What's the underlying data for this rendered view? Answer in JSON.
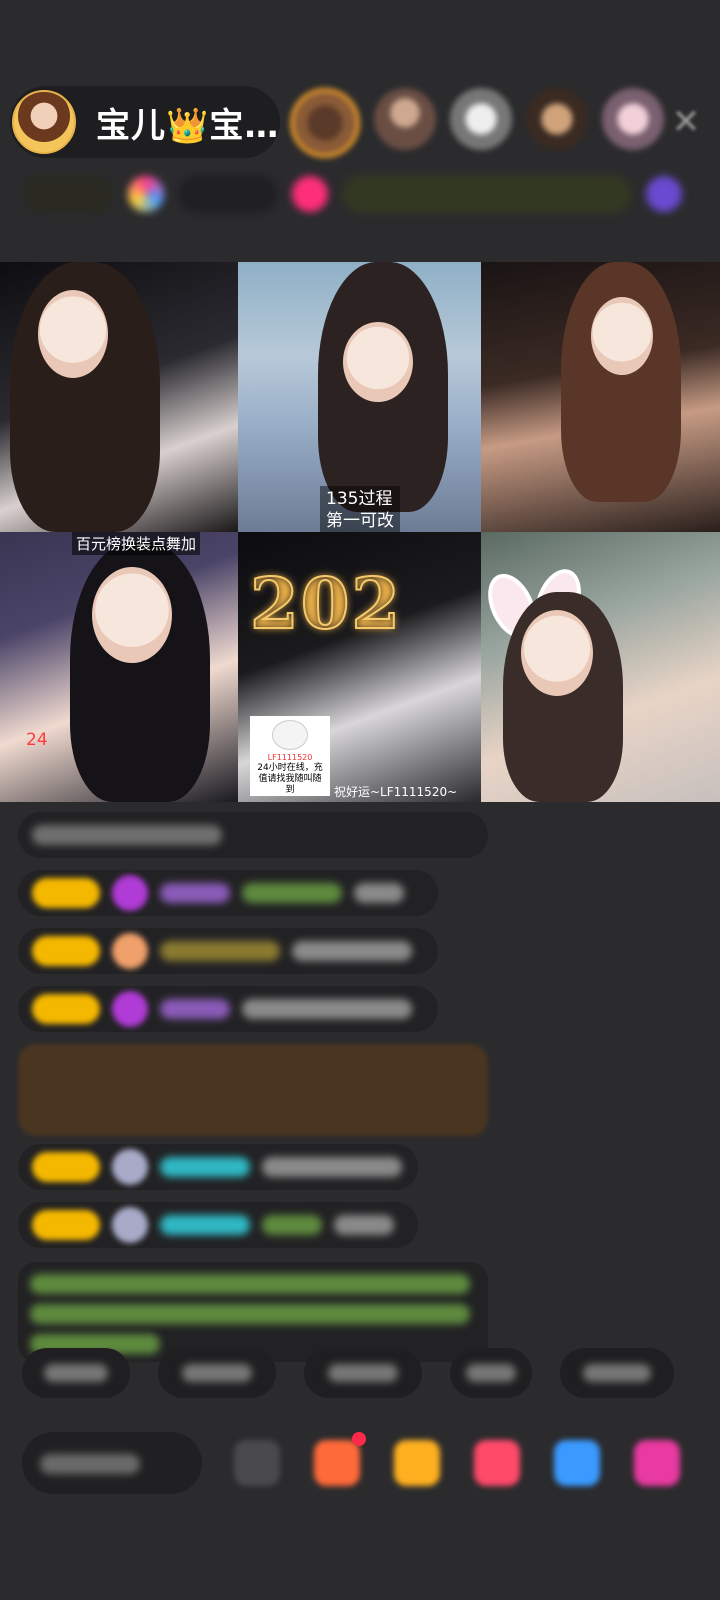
{
  "header": {
    "host_name": "宝儿👑宝…",
    "close_label": "✕"
  },
  "video_grid": {
    "tile1": {
      "label": ""
    },
    "tile2": {
      "label_line1": "135过程",
      "label_line2": "第一可改"
    },
    "tile4": {
      "top_label": "百元榜换装点舞加",
      "number": "24"
    },
    "tile5": {
      "lights_text": "202",
      "note_id": "LF1111520",
      "note_line1": "24小时在线，充",
      "note_line2": "值请找我随叫随",
      "note_line3": "到",
      "bottom_label": "祝好运~LF1111520~"
    }
  },
  "colors": {
    "background": "#2b2b2d",
    "badge_gold": "#f5b800",
    "purple": "#b03bd6",
    "green_text": "#7bc85a",
    "teal_text": "#2fb8c4"
  }
}
